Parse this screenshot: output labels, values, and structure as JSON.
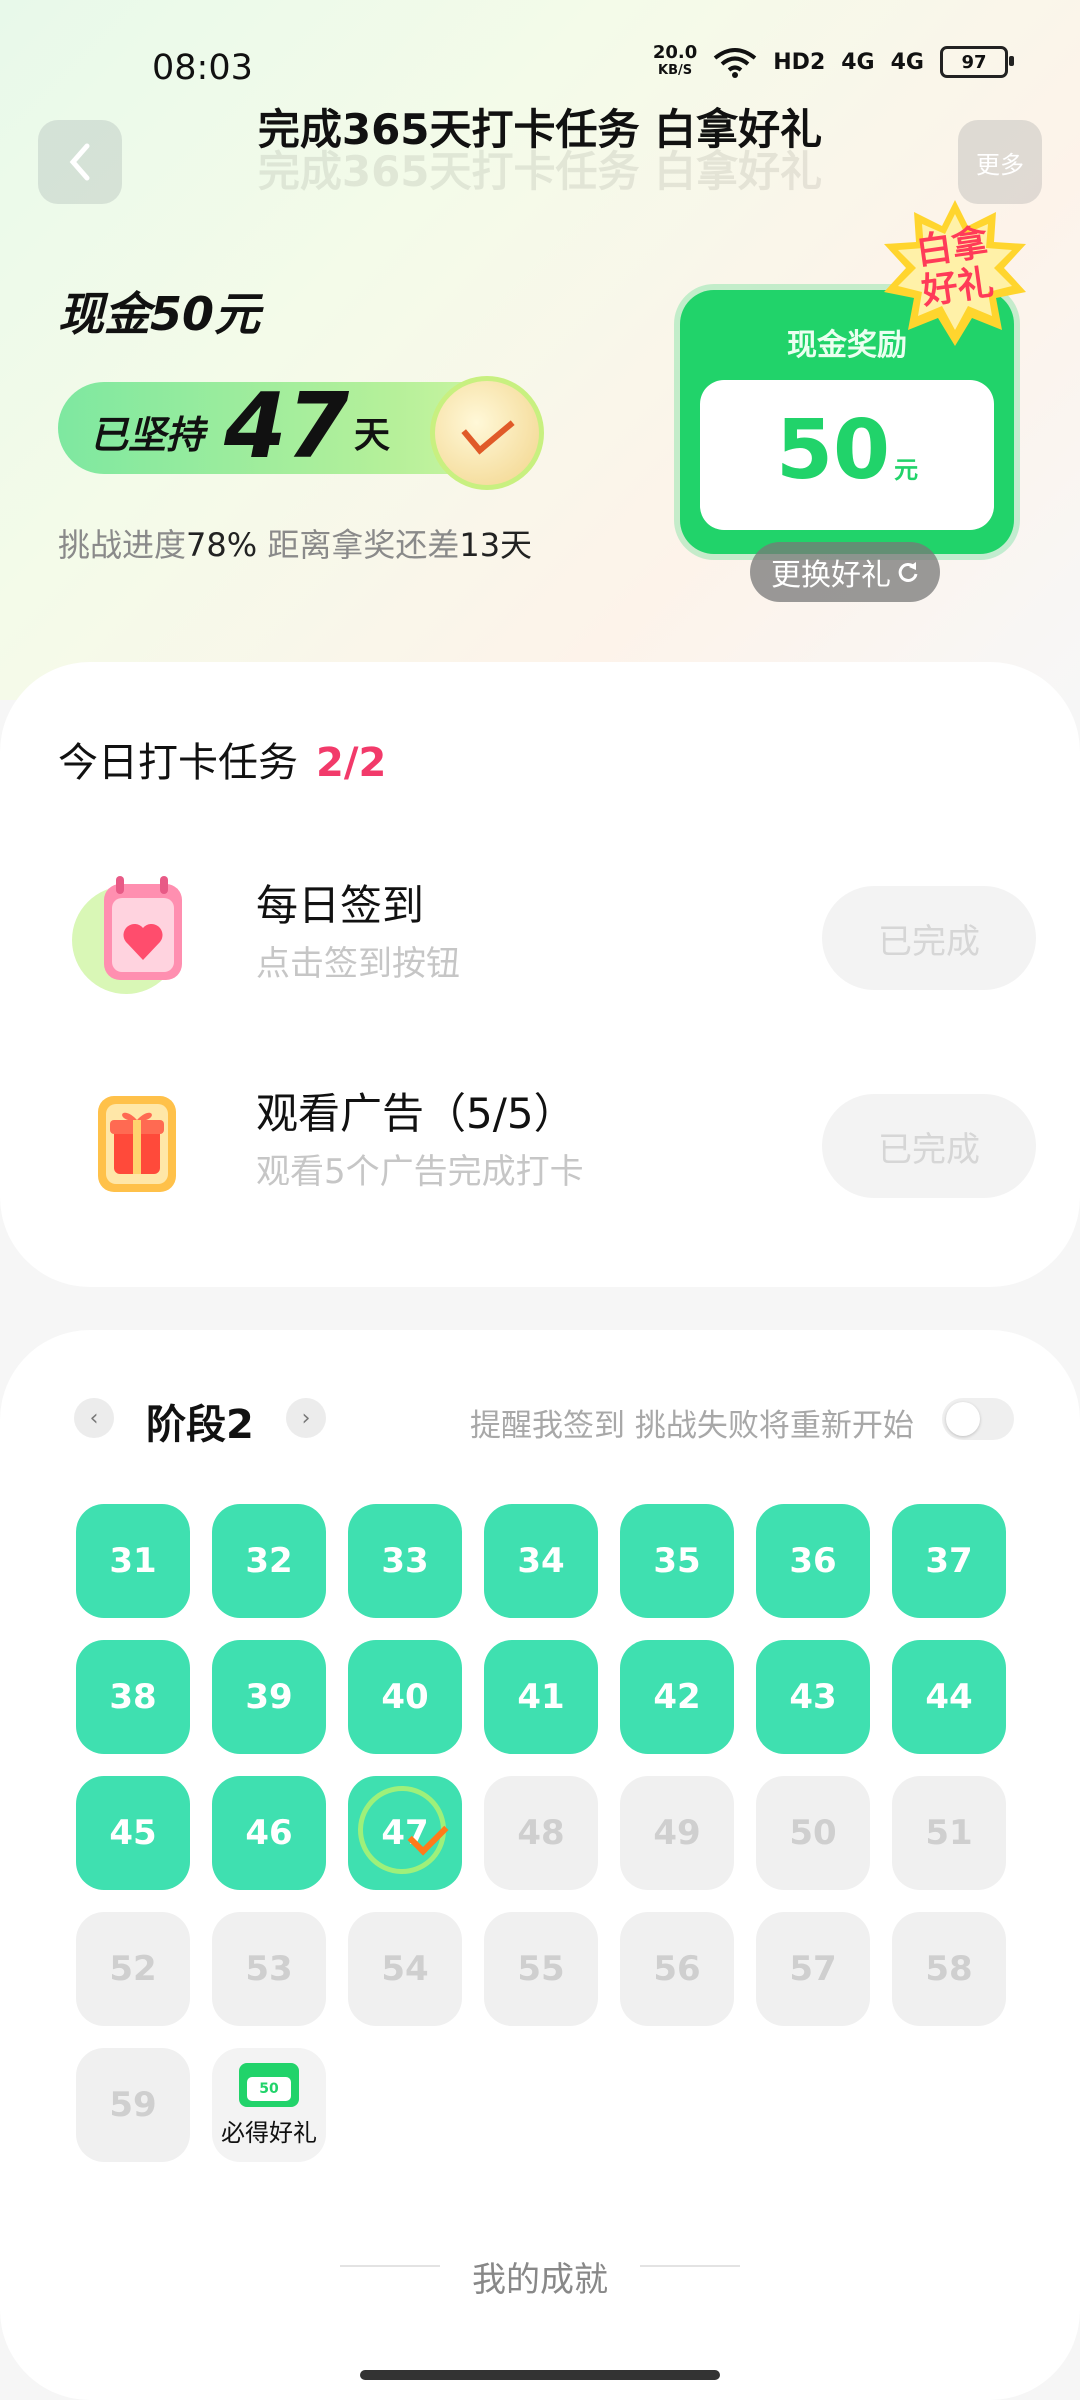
{
  "status_bar": {
    "time": "08:03",
    "net_speed_value": "20.0",
    "net_speed_unit": "KB/S",
    "hd": "HD2",
    "sig1": "4G",
    "sig2": "4G",
    "battery": "97"
  },
  "header": {
    "title": "完成365天打卡任务 白拿好礼",
    "back_icon": "chevron-left-icon",
    "more_label": "更多"
  },
  "challenge": {
    "cash_title": "现金50元",
    "persist_prefix": "已坚持",
    "persist_days": "47",
    "persist_suffix": "天",
    "progress_label": "挑战进度",
    "progress_value": "78%",
    "remain_label": "距离拿奖还差",
    "remain_value": "13天"
  },
  "reward": {
    "label": "现金奖励",
    "value": "50",
    "unit": "元",
    "badge_line1": "白拿",
    "badge_line2": "好礼",
    "change_label": "更换好礼",
    "accent": "#21d36a"
  },
  "tasks": {
    "title": "今日打卡任务",
    "count": "2/2",
    "items": [
      {
        "name": "每日签到",
        "desc": "点击签到按钮",
        "button": "已完成",
        "icon": "calendar-heart-icon"
      },
      {
        "name": "观看广告（5/5）",
        "desc": "观看5个广告完成打卡",
        "button": "已完成",
        "icon": "gift-box-icon"
      }
    ]
  },
  "stage": {
    "title": "阶段2",
    "remind_text": "提醒我签到 挑战失败将重新开始",
    "reminder_on": false,
    "days": [
      {
        "label": "31",
        "state": "done"
      },
      {
        "label": "32",
        "state": "done"
      },
      {
        "label": "33",
        "state": "done"
      },
      {
        "label": "34",
        "state": "done"
      },
      {
        "label": "35",
        "state": "done"
      },
      {
        "label": "36",
        "state": "done"
      },
      {
        "label": "37",
        "state": "done"
      },
      {
        "label": "38",
        "state": "done"
      },
      {
        "label": "39",
        "state": "done"
      },
      {
        "label": "40",
        "state": "done"
      },
      {
        "label": "41",
        "state": "done"
      },
      {
        "label": "42",
        "state": "done"
      },
      {
        "label": "43",
        "state": "done"
      },
      {
        "label": "44",
        "state": "done"
      },
      {
        "label": "45",
        "state": "done"
      },
      {
        "label": "46",
        "state": "done"
      },
      {
        "label": "47",
        "state": "current"
      },
      {
        "label": "48",
        "state": "future"
      },
      {
        "label": "49",
        "state": "future"
      },
      {
        "label": "50",
        "state": "future"
      },
      {
        "label": "51",
        "state": "future"
      },
      {
        "label": "52",
        "state": "future"
      },
      {
        "label": "53",
        "state": "future"
      },
      {
        "label": "54",
        "state": "future"
      },
      {
        "label": "55",
        "state": "future"
      },
      {
        "label": "56",
        "state": "future"
      },
      {
        "label": "57",
        "state": "future"
      },
      {
        "label": "58",
        "state": "future"
      },
      {
        "label": "59",
        "state": "future"
      }
    ],
    "final_gift": {
      "mini_value": "50",
      "label": "必得好礼"
    }
  },
  "achievements": {
    "title": "我的成就"
  }
}
